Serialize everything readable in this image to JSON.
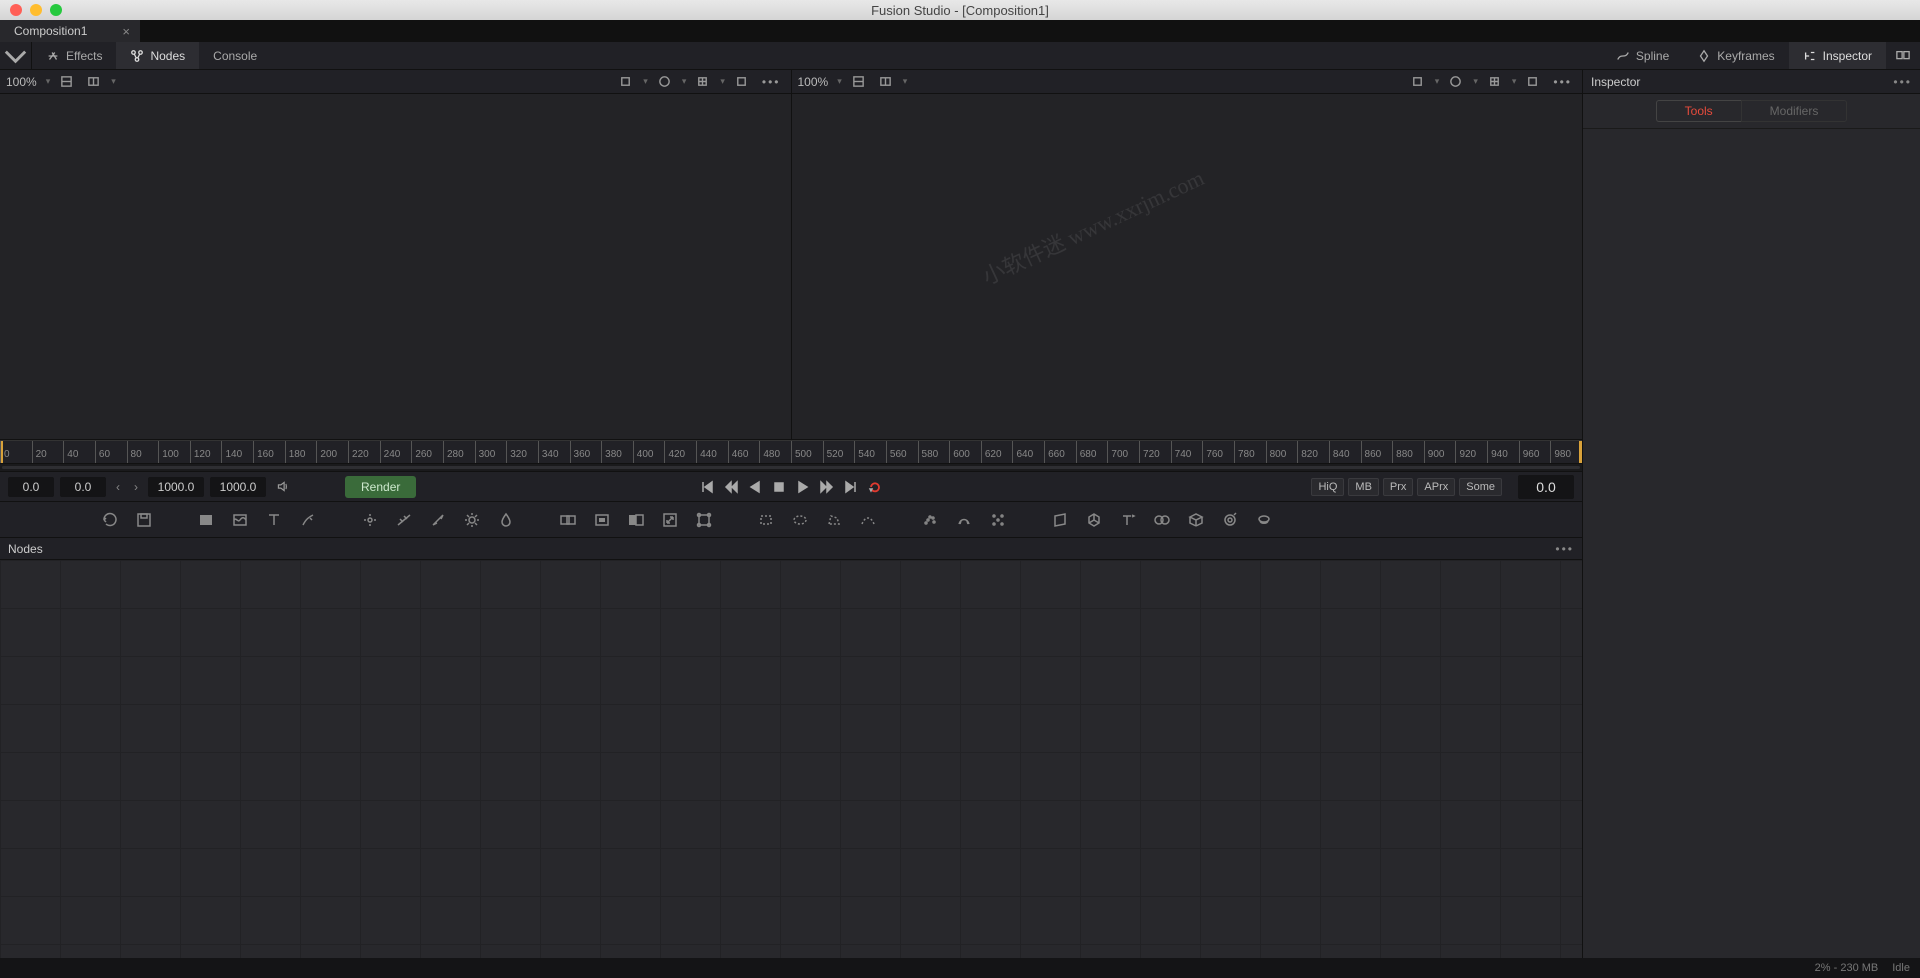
{
  "titlebar": {
    "title": "Fusion Studio - [Composition1]"
  },
  "tab": {
    "name": "Composition1",
    "close": "×"
  },
  "toolbar": {
    "effects": "Effects",
    "nodes": "Nodes",
    "console": "Console",
    "spline": "Spline",
    "keyframes": "Keyframes",
    "inspector": "Inspector"
  },
  "viewer": {
    "zoom_left": "100%",
    "zoom_right": "100%"
  },
  "inspector": {
    "title": "Inspector",
    "tab_tools": "Tools",
    "tab_modifiers": "Modifiers"
  },
  "ruler": {
    "ticks": [
      "0",
      "20",
      "40",
      "60",
      "80",
      "100",
      "120",
      "140",
      "160",
      "180",
      "200",
      "220",
      "240",
      "260",
      "280",
      "300",
      "320",
      "340",
      "360",
      "380",
      "400",
      "420",
      "440",
      "460",
      "480",
      "500",
      "520",
      "540",
      "560",
      "580",
      "600",
      "620",
      "640",
      "660",
      "680",
      "700",
      "720",
      "740",
      "760",
      "780",
      "800",
      "820",
      "840",
      "860",
      "880",
      "900",
      "920",
      "940",
      "960",
      "980"
    ]
  },
  "playbar": {
    "in": "0.0",
    "start": "0.0",
    "end": "1000.0",
    "out": "1000.0",
    "render": "Render",
    "hiq": "HiQ",
    "mb": "MB",
    "prx": "Prx",
    "aprx": "APrx",
    "some": "Some",
    "current": "0.0"
  },
  "nodes_panel": {
    "title": "Nodes"
  },
  "statusbar": {
    "mem": "2% - 230 MB",
    "state": "Idle"
  },
  "watermark_text": "小软件迷 www.xxrjm.com"
}
